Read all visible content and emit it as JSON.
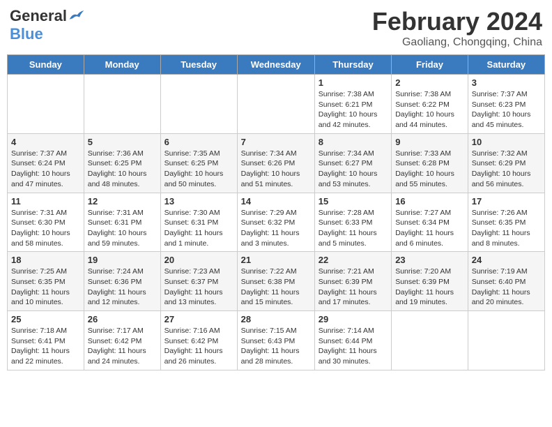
{
  "logo": {
    "general": "General",
    "blue": "Blue"
  },
  "title": "February 2024",
  "subtitle": "Gaoliang, Chongqing, China",
  "weekdays": [
    "Sunday",
    "Monday",
    "Tuesday",
    "Wednesday",
    "Thursday",
    "Friday",
    "Saturday"
  ],
  "weeks": [
    [
      {
        "day": "",
        "info": ""
      },
      {
        "day": "",
        "info": ""
      },
      {
        "day": "",
        "info": ""
      },
      {
        "day": "",
        "info": ""
      },
      {
        "day": "1",
        "info": "Sunrise: 7:38 AM\nSunset: 6:21 PM\nDaylight: 10 hours\nand 42 minutes."
      },
      {
        "day": "2",
        "info": "Sunrise: 7:38 AM\nSunset: 6:22 PM\nDaylight: 10 hours\nand 44 minutes."
      },
      {
        "day": "3",
        "info": "Sunrise: 7:37 AM\nSunset: 6:23 PM\nDaylight: 10 hours\nand 45 minutes."
      }
    ],
    [
      {
        "day": "4",
        "info": "Sunrise: 7:37 AM\nSunset: 6:24 PM\nDaylight: 10 hours\nand 47 minutes."
      },
      {
        "day": "5",
        "info": "Sunrise: 7:36 AM\nSunset: 6:25 PM\nDaylight: 10 hours\nand 48 minutes."
      },
      {
        "day": "6",
        "info": "Sunrise: 7:35 AM\nSunset: 6:25 PM\nDaylight: 10 hours\nand 50 minutes."
      },
      {
        "day": "7",
        "info": "Sunrise: 7:34 AM\nSunset: 6:26 PM\nDaylight: 10 hours\nand 51 minutes."
      },
      {
        "day": "8",
        "info": "Sunrise: 7:34 AM\nSunset: 6:27 PM\nDaylight: 10 hours\nand 53 minutes."
      },
      {
        "day": "9",
        "info": "Sunrise: 7:33 AM\nSunset: 6:28 PM\nDaylight: 10 hours\nand 55 minutes."
      },
      {
        "day": "10",
        "info": "Sunrise: 7:32 AM\nSunset: 6:29 PM\nDaylight: 10 hours\nand 56 minutes."
      }
    ],
    [
      {
        "day": "11",
        "info": "Sunrise: 7:31 AM\nSunset: 6:30 PM\nDaylight: 10 hours\nand 58 minutes."
      },
      {
        "day": "12",
        "info": "Sunrise: 7:31 AM\nSunset: 6:31 PM\nDaylight: 10 hours\nand 59 minutes."
      },
      {
        "day": "13",
        "info": "Sunrise: 7:30 AM\nSunset: 6:31 PM\nDaylight: 11 hours\nand 1 minute."
      },
      {
        "day": "14",
        "info": "Sunrise: 7:29 AM\nSunset: 6:32 PM\nDaylight: 11 hours\nand 3 minutes."
      },
      {
        "day": "15",
        "info": "Sunrise: 7:28 AM\nSunset: 6:33 PM\nDaylight: 11 hours\nand 5 minutes."
      },
      {
        "day": "16",
        "info": "Sunrise: 7:27 AM\nSunset: 6:34 PM\nDaylight: 11 hours\nand 6 minutes."
      },
      {
        "day": "17",
        "info": "Sunrise: 7:26 AM\nSunset: 6:35 PM\nDaylight: 11 hours\nand 8 minutes."
      }
    ],
    [
      {
        "day": "18",
        "info": "Sunrise: 7:25 AM\nSunset: 6:35 PM\nDaylight: 11 hours\nand 10 minutes."
      },
      {
        "day": "19",
        "info": "Sunrise: 7:24 AM\nSunset: 6:36 PM\nDaylight: 11 hours\nand 12 minutes."
      },
      {
        "day": "20",
        "info": "Sunrise: 7:23 AM\nSunset: 6:37 PM\nDaylight: 11 hours\nand 13 minutes."
      },
      {
        "day": "21",
        "info": "Sunrise: 7:22 AM\nSunset: 6:38 PM\nDaylight: 11 hours\nand 15 minutes."
      },
      {
        "day": "22",
        "info": "Sunrise: 7:21 AM\nSunset: 6:39 PM\nDaylight: 11 hours\nand 17 minutes."
      },
      {
        "day": "23",
        "info": "Sunrise: 7:20 AM\nSunset: 6:39 PM\nDaylight: 11 hours\nand 19 minutes."
      },
      {
        "day": "24",
        "info": "Sunrise: 7:19 AM\nSunset: 6:40 PM\nDaylight: 11 hours\nand 20 minutes."
      }
    ],
    [
      {
        "day": "25",
        "info": "Sunrise: 7:18 AM\nSunset: 6:41 PM\nDaylight: 11 hours\nand 22 minutes."
      },
      {
        "day": "26",
        "info": "Sunrise: 7:17 AM\nSunset: 6:42 PM\nDaylight: 11 hours\nand 24 minutes."
      },
      {
        "day": "27",
        "info": "Sunrise: 7:16 AM\nSunset: 6:42 PM\nDaylight: 11 hours\nand 26 minutes."
      },
      {
        "day": "28",
        "info": "Sunrise: 7:15 AM\nSunset: 6:43 PM\nDaylight: 11 hours\nand 28 minutes."
      },
      {
        "day": "29",
        "info": "Sunrise: 7:14 AM\nSunset: 6:44 PM\nDaylight: 11 hours\nand 30 minutes."
      },
      {
        "day": "",
        "info": ""
      },
      {
        "day": "",
        "info": ""
      }
    ]
  ]
}
